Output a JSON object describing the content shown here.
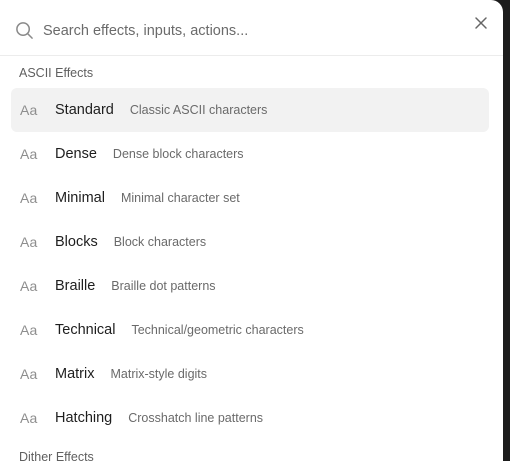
{
  "search": {
    "placeholder": "Search effects, inputs, actions..."
  },
  "sections": [
    {
      "label": "ASCII Effects",
      "items": [
        {
          "icon": "Aa",
          "name": "Standard",
          "desc": "Classic ASCII characters",
          "selected": true
        },
        {
          "icon": "Aa",
          "name": "Dense",
          "desc": "Dense block characters"
        },
        {
          "icon": "Aa",
          "name": "Minimal",
          "desc": "Minimal character set"
        },
        {
          "icon": "Aa",
          "name": "Blocks",
          "desc": "Block characters"
        },
        {
          "icon": "Aa",
          "name": "Braille",
          "desc": "Braille dot patterns"
        },
        {
          "icon": "Aa",
          "name": "Technical",
          "desc": "Technical/geometric characters"
        },
        {
          "icon": "Aa",
          "name": "Matrix",
          "desc": "Matrix-style digits"
        },
        {
          "icon": "Aa",
          "name": "Hatching",
          "desc": "Crosshatch line patterns"
        }
      ]
    },
    {
      "label": "Dither Effects"
    }
  ],
  "colors": {
    "background": "#1c1c1c",
    "panel": "#ffffff",
    "selected_row": "#f2f2f2"
  }
}
